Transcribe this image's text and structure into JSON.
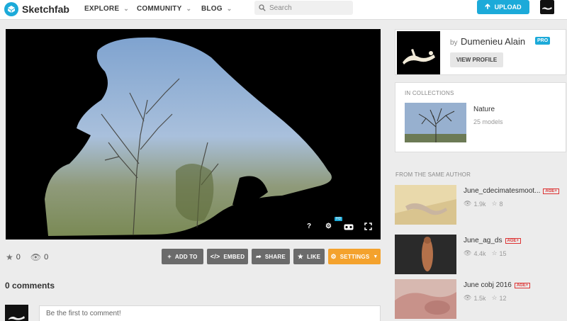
{
  "header": {
    "brand": "Sketchfab",
    "nav": [
      {
        "label": "EXPLORE"
      },
      {
        "label": "COMMUNITY"
      },
      {
        "label": "BLOG"
      }
    ],
    "search_placeholder": "Search",
    "upload_label": "UPLOAD"
  },
  "viewer": {
    "controls": [
      "?",
      "settings-icon",
      "vr-icon",
      "fullscreen-icon"
    ],
    "hd_badge": "HD"
  },
  "stats": {
    "likes": "0",
    "views": "0"
  },
  "actions": {
    "add_to": "ADD TO",
    "embed": "EMBED",
    "share": "SHARE",
    "like": "LIKE",
    "settings": "SETTINGS"
  },
  "comments": {
    "title": "0 comments",
    "placeholder": "Be the first to comment!"
  },
  "author": {
    "by": "by",
    "name": "Dumenieu Alain",
    "badge": "PRO",
    "view_profile": "VIEW PROFILE"
  },
  "collections": {
    "heading": "IN COLLECTIONS",
    "items": [
      {
        "name": "Nature",
        "count": "25 models"
      }
    ]
  },
  "same_author": {
    "heading": "FROM THE SAME AUTHOR",
    "models": [
      {
        "title": "June_cdecimatesmoot...",
        "badge": "AGE+",
        "views": "1.9k",
        "likes": "8"
      },
      {
        "title": "June_ag_ds",
        "badge": "AGE+",
        "views": "4.4k",
        "likes": "15"
      },
      {
        "title": "June cobj 2016",
        "badge": "AGE+",
        "views": "1.5k",
        "likes": "12"
      }
    ]
  },
  "colors": {
    "accent": "#1caad9",
    "settings": "#f4a22d",
    "action_button": "#6b6b6b",
    "age_badge": "#dd3333"
  }
}
